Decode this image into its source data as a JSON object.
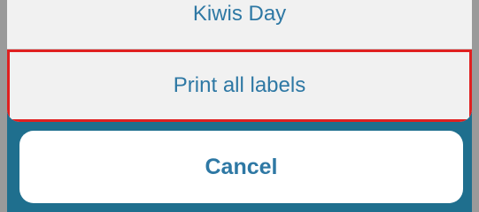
{
  "action_sheet": {
    "items": [
      {
        "label": "Kiwis Day"
      },
      {
        "label": "Print all labels"
      }
    ],
    "cancel_label": "Cancel"
  }
}
